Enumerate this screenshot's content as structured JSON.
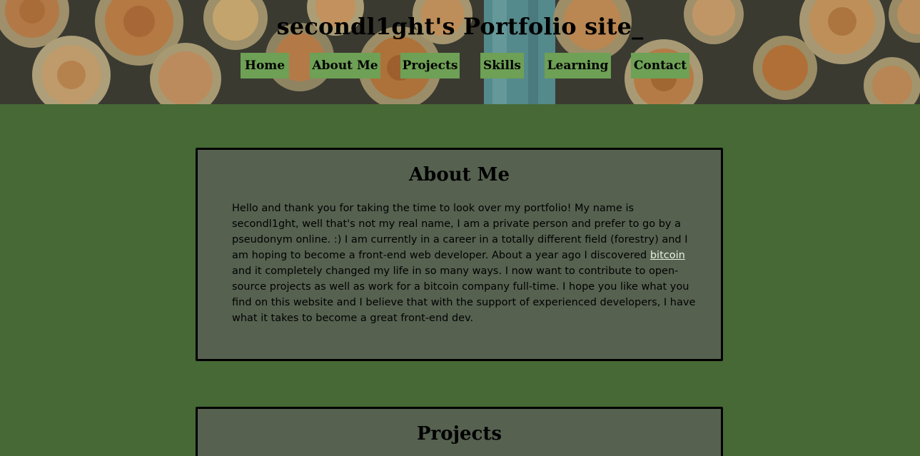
{
  "header": {
    "title": "secondl1ght's Portfolio site_"
  },
  "nav": {
    "items": [
      {
        "label": "Home"
      },
      {
        "label": "About Me"
      },
      {
        "label": "Projects"
      },
      {
        "label": "Skills"
      },
      {
        "label": "Learning"
      },
      {
        "label": "Contact"
      }
    ]
  },
  "about": {
    "heading": "About Me",
    "lines": [
      "Hello and thank you for taking the time to look over my portfolio! My name is",
      "secondl1ght, well that's not my real name, I am a private person and prefer to go by a",
      "pseudonym online. :) I am currently in a career in a totally different field (forestry) and I",
      "am hoping to become a front-end web developer. About a year ago I discovered "
    ],
    "link_text": "bitcoin",
    "lines_after": [
      "and it completely changed my life in so many ways. I now want to contribute to open-",
      "source projects as well as work for a bitcoin company full-time. I hope you like what you",
      "find on this website and I believe that with the support of experienced developers, I have",
      "what it takes to become a great front-end dev."
    ]
  },
  "projects": {
    "heading": "Projects"
  },
  "colors": {
    "background": "#466935",
    "card": "#566150",
    "nav_button": "#6ea055",
    "link": "#e6f3dc"
  }
}
